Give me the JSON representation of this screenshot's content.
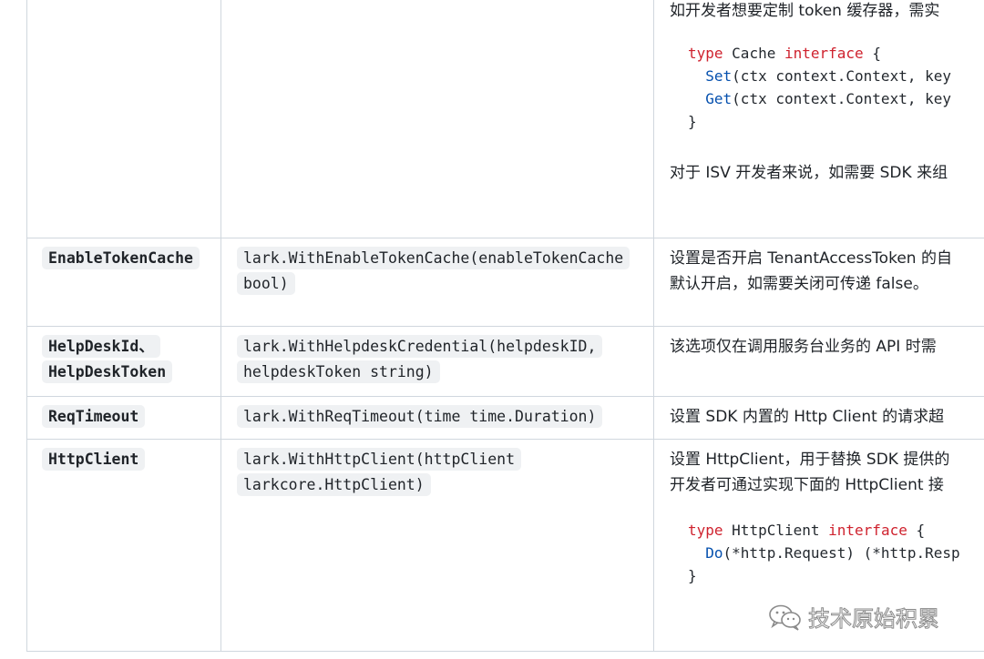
{
  "rows": [
    {
      "desc": [
        "如开发者想要定制 token 缓存器，需实"
      ],
      "code": {
        "l1": {
          "kw1": "type",
          "name": "Cache",
          "kw2": "interface",
          "brace": "{"
        },
        "l2": {
          "fn": "Set",
          "rest": "(ctx context.Context, key"
        },
        "l3": {
          "fn": "Get",
          "rest": "(ctx context.Context, key"
        },
        "l4": "}"
      },
      "after": "对于 ISV 开发者来说，如需要 SDK 来组"
    },
    {
      "option": "EnableTokenCache",
      "signature": "lark.WithEnableTokenCache(enableTokenCache bool)",
      "desc": [
        "设置是否开启 TenantAccessToken 的自",
        "默认开启，如需要关闭可传递 false。"
      ]
    },
    {
      "option": "HelpDeskId、 HelpDeskToken",
      "signature": "lark.WithHelpdeskCredential(helpdeskID, helpdeskToken string)",
      "desc": [
        "该选项仅在调用服务台业务的 API 时需"
      ]
    },
    {
      "option": "ReqTimeout",
      "signature": "lark.WithReqTimeout(time time.Duration)",
      "desc": [
        "设置 SDK 内置的 Http Client 的请求超"
      ]
    },
    {
      "option": "HttpClient",
      "signature": "lark.WithHttpClient(httpClient larkcore.HttpClient)",
      "desc": [
        "设置 HttpClient，用于替换 SDK 提供的",
        "开发者可通过实现下面的 HttpClient 接"
      ],
      "code": {
        "l1": {
          "kw1": "type",
          "name": "HttpClient",
          "kw2": "interface",
          "brace": "{"
        },
        "l2": {
          "fn": "Do",
          "rest": "(*http.Request) (*http.Resp"
        },
        "l3": "}"
      }
    }
  ],
  "watermark": {
    "text": "技术原始积累",
    "icon": "wechat-icon"
  }
}
